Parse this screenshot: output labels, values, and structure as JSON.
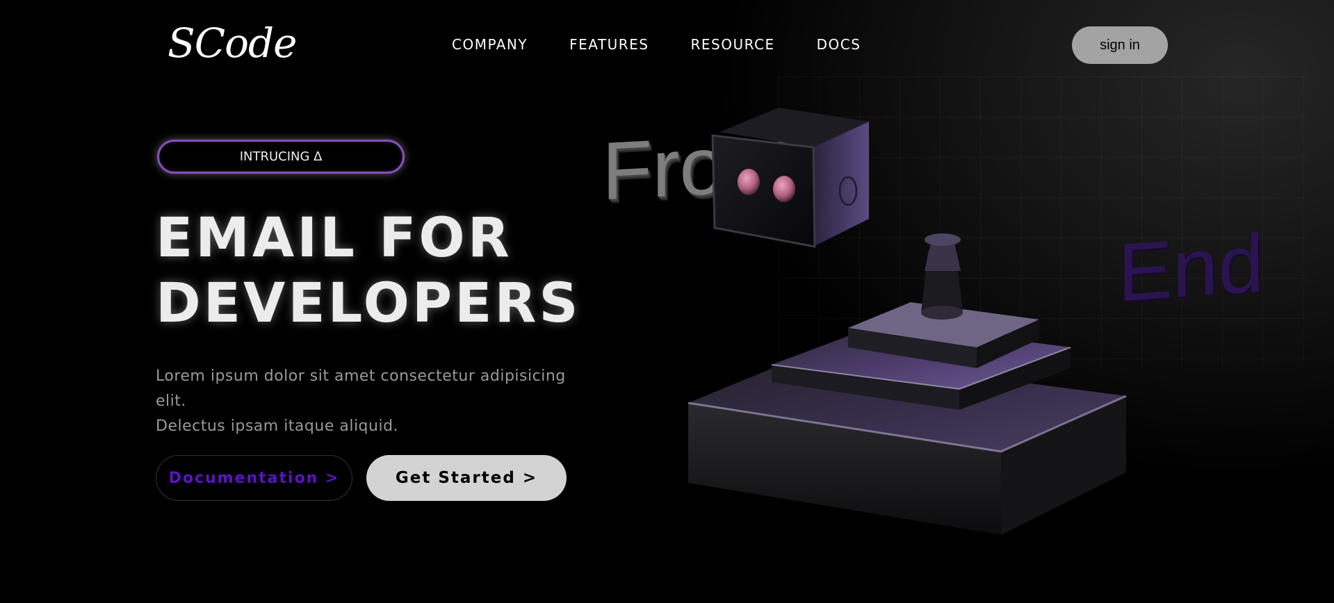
{
  "brand": {
    "logo": "SCode"
  },
  "nav": {
    "items": [
      {
        "label": "COMPANY"
      },
      {
        "label": "FEATURES"
      },
      {
        "label": "RESOURCE"
      },
      {
        "label": "DOCS"
      }
    ],
    "signin_label": "sign in"
  },
  "hero": {
    "badge": "INTRUCING ∆",
    "title_line1": "EMAIL FOR",
    "title_line2": "DEVELOPERS",
    "desc_line1": "Lorem ipsum dolor sit amet consectetur adipisicing elit.",
    "desc_line2": "Delectus ipsam itaque aliquid.",
    "doc_button": "Documentation >",
    "start_button": "Get Started >"
  },
  "illustration": {
    "word1": "Front",
    "word2": "End",
    "icon": "robot-3d-illustration"
  },
  "colors": {
    "background": "#000000",
    "accent_purple": "#5a14c4",
    "badge_border": "#8b4cc3",
    "signin_bg": "#a3a3a3",
    "start_bg": "#d3d3d3"
  }
}
